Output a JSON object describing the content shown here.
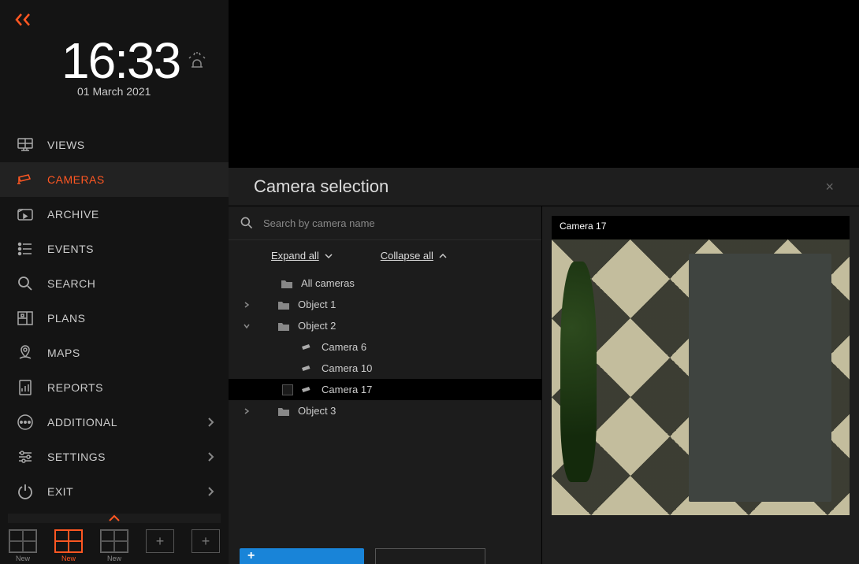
{
  "clock": {
    "time": "16:33",
    "date": "01 March 2021"
  },
  "sidebar": {
    "items": [
      {
        "label": "VIEWS",
        "icon": "views",
        "active": false,
        "expandable": false
      },
      {
        "label": "CAMERAS",
        "icon": "cameras",
        "active": true,
        "expandable": false
      },
      {
        "label": "ARCHIVE",
        "icon": "archive",
        "active": false,
        "expandable": false
      },
      {
        "label": "EVENTS",
        "icon": "events",
        "active": false,
        "expandable": false
      },
      {
        "label": "SEARCH",
        "icon": "search",
        "active": false,
        "expandable": false
      },
      {
        "label": "PLANS",
        "icon": "plans",
        "active": false,
        "expandable": false
      },
      {
        "label": "MAPS",
        "icon": "maps",
        "active": false,
        "expandable": false
      },
      {
        "label": "REPORTS",
        "icon": "reports",
        "active": false,
        "expandable": false
      },
      {
        "label": "ADDITIONAL",
        "icon": "more",
        "active": false,
        "expandable": true
      },
      {
        "label": "SETTINGS",
        "icon": "settings",
        "active": false,
        "expandable": true
      },
      {
        "label": "EXIT",
        "icon": "exit",
        "active": false,
        "expandable": true
      }
    ],
    "layouts": {
      "new_label": "New",
      "sel_label": "New",
      "std_label": "New"
    }
  },
  "panel": {
    "title": "Camera selection",
    "close": "×",
    "search_placeholder": "Search by camera name",
    "expand_all": "Expand all",
    "collapse_all": "Collapse all",
    "tree": {
      "all": "All cameras",
      "obj1": "Object 1",
      "obj2": "Object 2",
      "obj3": "Object 3",
      "cam6": "Camera 6",
      "cam10": "Camera 10",
      "cam17": "Camera 17"
    },
    "preview_label": "Camera 17"
  }
}
